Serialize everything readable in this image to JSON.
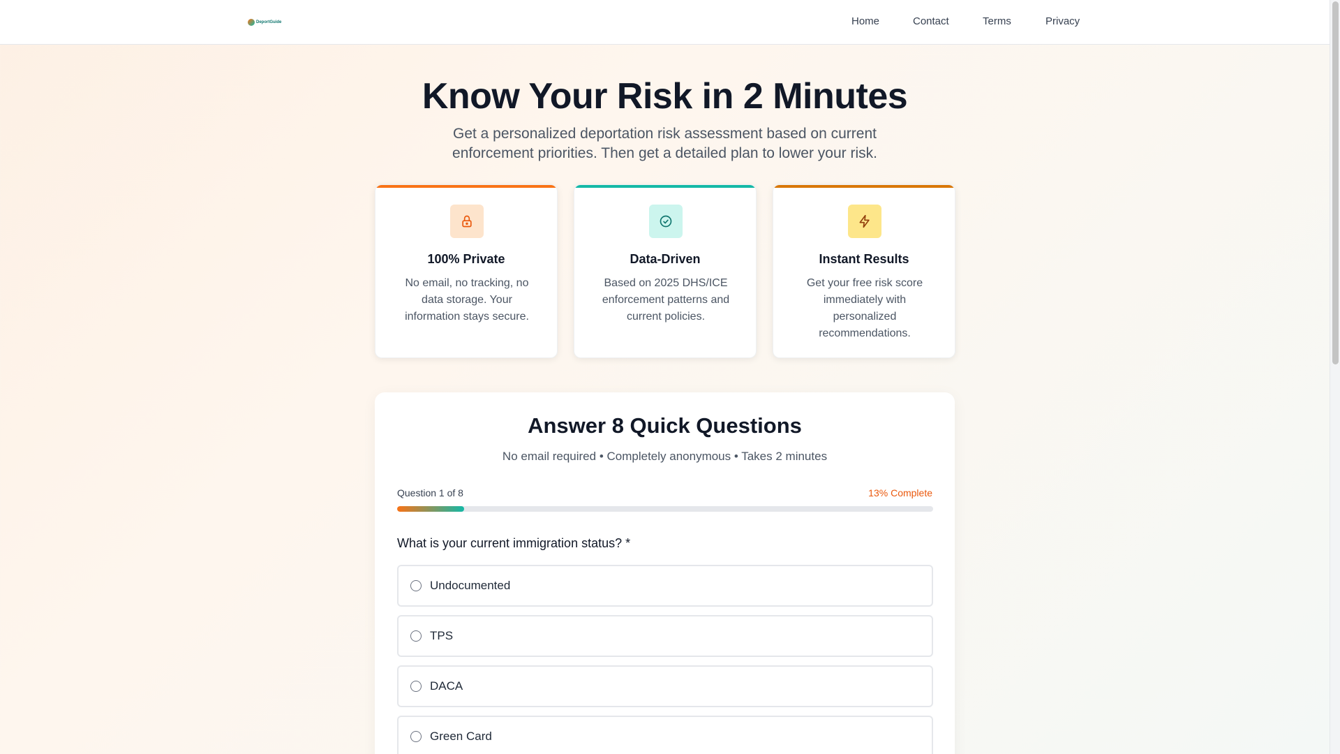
{
  "brand": {
    "logo_text": "DeportGuide"
  },
  "nav": {
    "items": [
      "Home",
      "Contact",
      "Terms",
      "Privacy"
    ]
  },
  "hero": {
    "title": "Know Your Risk in 2 Minutes",
    "subtitle": "Get a personalized deportation risk assessment based on current enforcement priorities. Then get a detailed plan to lower your risk."
  },
  "features": [
    {
      "title": "100% Private",
      "text": "No email, no tracking, no data storage. Your information stays secure.",
      "icon": "lock-icon",
      "accent": "#f97316",
      "icon_bg": "#fde4cc"
    },
    {
      "title": "Data-Driven",
      "text": "Based on 2025 DHS/ICE enforcement patterns and current policies.",
      "icon": "check-circle-icon",
      "accent": "#14b8a6",
      "icon_bg": "#ccf5ee"
    },
    {
      "title": "Instant Results",
      "text": "Get your free risk score immediately with personalized recommendations.",
      "icon": "lightning-icon",
      "accent": "#d97706",
      "icon_bg": "#fde68a"
    }
  ],
  "quiz": {
    "title": "Answer 8 Quick Questions",
    "subtitle": "No email required • Completely anonymous • Takes 2 minutes",
    "progress_label": "Question 1 of 8",
    "progress_pct_label": "13% Complete",
    "progress_fraction": 0.125,
    "question": "What is your current immigration status? *",
    "options": [
      "Undocumented",
      "TPS",
      "DACA",
      "Green Card"
    ]
  }
}
